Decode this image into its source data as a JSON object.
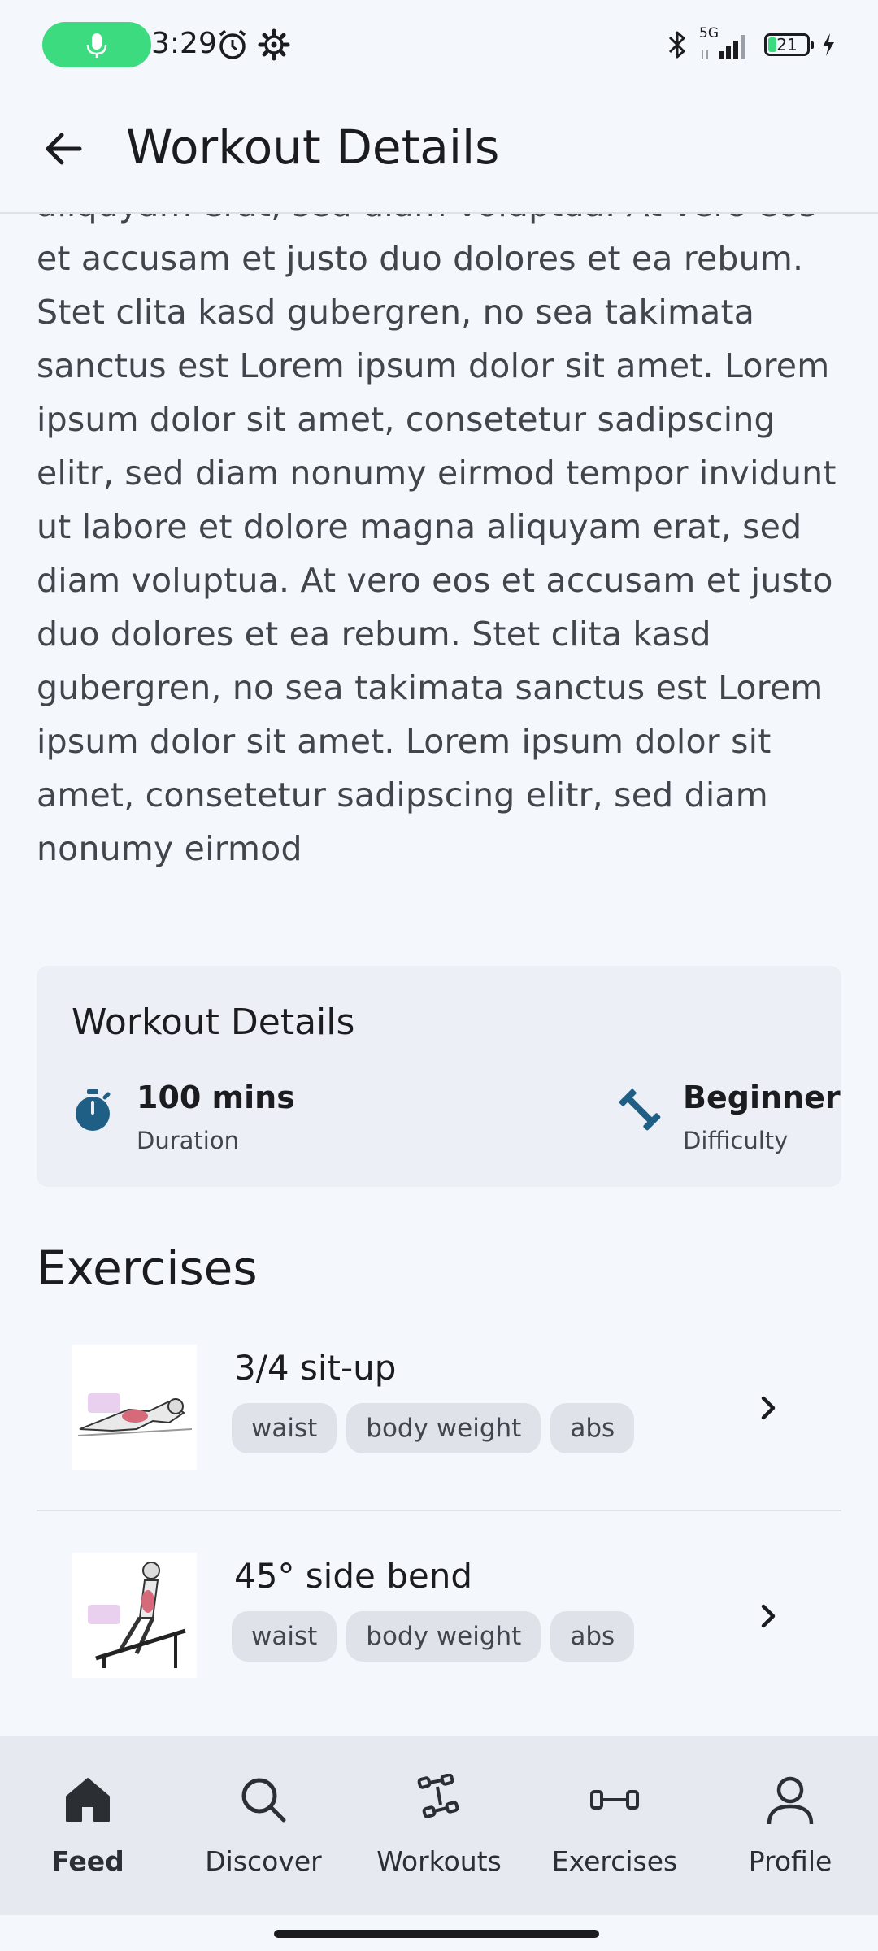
{
  "status_bar": {
    "time": "3:29",
    "network": "5G",
    "battery": "21"
  },
  "app_bar": {
    "title": "Workout Details"
  },
  "description": "aliquyam erat, sed diam voluptua. At vero eos et accusam et justo duo dolores et ea rebum. Stet clita kasd gubergren, no sea takimata sanctus est Lorem ipsum dolor sit amet. Lorem ipsum dolor sit amet, consetetur sadipscing elitr, sed diam nonumy eirmod tempor invidunt ut labore et dolore magna aliquyam erat, sed diam voluptua. At vero eos et accusam et justo duo dolores et ea rebum. Stet clita kasd gubergren, no sea takimata sanctus est Lorem ipsum dolor sit amet. Lorem ipsum dolor sit amet, consetetur sadipscing elitr, sed diam nonumy eirmod",
  "details_card": {
    "title": "Workout Details",
    "duration": {
      "value": "100 mins",
      "label": "Duration",
      "icon": "stopwatch-icon"
    },
    "difficulty": {
      "value": "Beginner",
      "label": "Difficulty",
      "icon": "dumbbell-icon"
    }
  },
  "exercises": {
    "title": "Exercises",
    "items": [
      {
        "name": "3/4 sit-up",
        "tags": [
          "waist",
          "body weight",
          "abs"
        ]
      },
      {
        "name": "45° side bend",
        "tags": [
          "waist",
          "body weight",
          "abs"
        ]
      }
    ]
  },
  "bottom_nav": {
    "items": [
      {
        "label": "Feed",
        "icon": "home-icon",
        "active": true
      },
      {
        "label": "Discover",
        "icon": "search-icon",
        "active": false
      },
      {
        "label": "Workouts",
        "icon": "dumbbells-icon",
        "active": false
      },
      {
        "label": "Exercises",
        "icon": "barbell-icon",
        "active": false
      },
      {
        "label": "Profile",
        "icon": "person-icon",
        "active": false
      }
    ]
  },
  "colors": {
    "background": "#f4f7fc",
    "accent_icon": "#1f5f86",
    "mic_pill": "#3ddb7f"
  }
}
